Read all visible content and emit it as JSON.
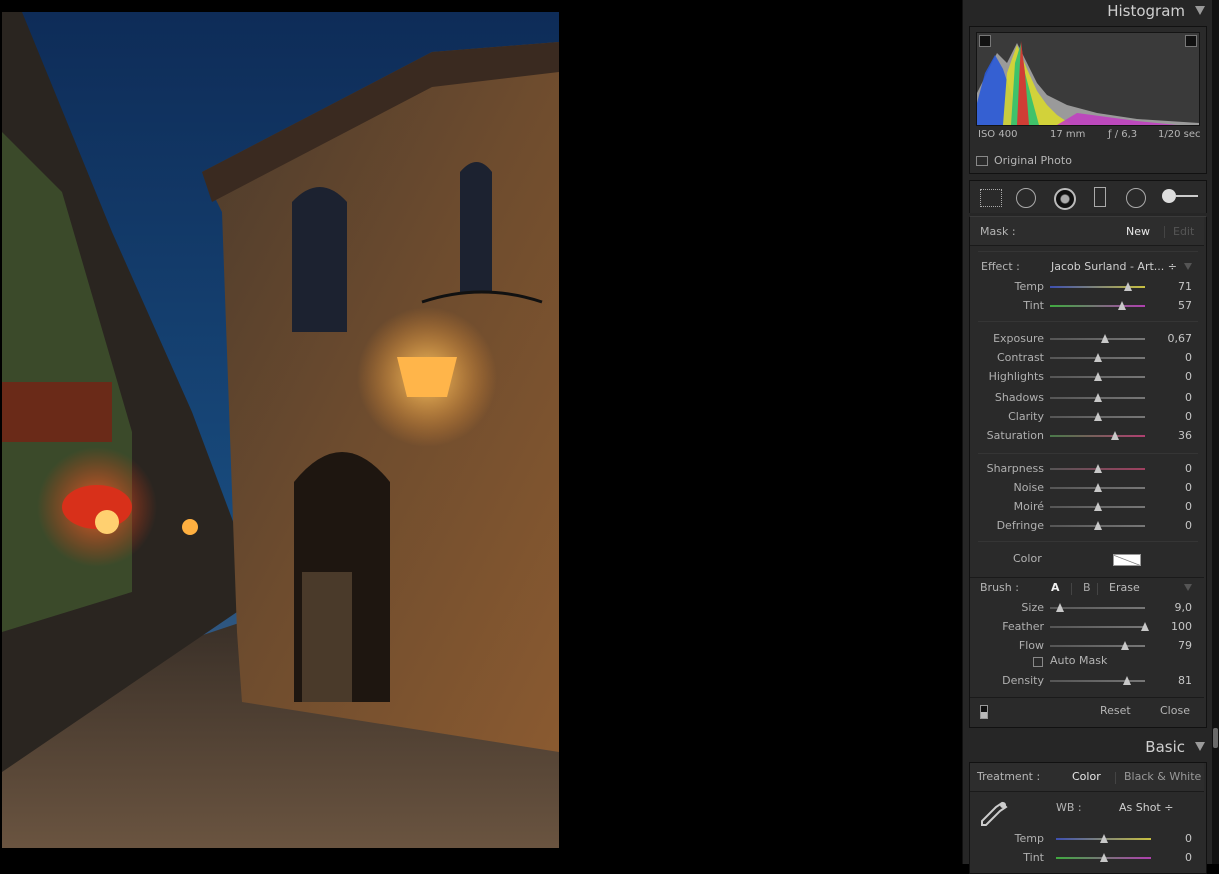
{
  "histogram": {
    "title": "Histogram",
    "iso": "ISO 400",
    "focal": "17 mm",
    "aperture": "ƒ / 6,3",
    "shutter": "1/20 sec",
    "original_photo": "Original Photo"
  },
  "mask": {
    "label": "Mask :",
    "new": "New",
    "edit": "Edit"
  },
  "effect": {
    "label": "Effect :",
    "preset": "Jacob Surland - Art... ÷",
    "sliders": [
      {
        "label": "Temp",
        "value": "71",
        "pos": 0.82,
        "gradient": "linear-gradient(90deg,#3d4fb0,#c8c040)"
      },
      {
        "label": "Tint",
        "value": "57",
        "pos": 0.76,
        "gradient": "linear-gradient(90deg,#3faa3f,#b03fb0)"
      },
      {
        "label": "Exposure",
        "value": "0,67",
        "pos": 0.58,
        "gradient": "linear-gradient(90deg,#555,#777)"
      },
      {
        "label": "Contrast",
        "value": "0",
        "pos": 0.5,
        "gradient": "linear-gradient(90deg,#555,#777)"
      },
      {
        "label": "Highlights",
        "value": "0",
        "pos": 0.5,
        "gradient": "linear-gradient(90deg,#555,#777)"
      },
      {
        "label": "Shadows",
        "value": "0",
        "pos": 0.5,
        "gradient": "linear-gradient(90deg,#555,#777)"
      },
      {
        "label": "Clarity",
        "value": "0",
        "pos": 0.5,
        "gradient": "linear-gradient(90deg,#555,#777)"
      },
      {
        "label": "Saturation",
        "value": "36",
        "pos": 0.68,
        "gradient": "linear-gradient(90deg,#4a7a4a,#b03f70)"
      },
      {
        "label": "Sharpness",
        "value": "0",
        "pos": 0.5,
        "gradient": "linear-gradient(90deg,#555,#a04060)"
      },
      {
        "label": "Noise",
        "value": "0",
        "pos": 0.5,
        "gradient": "linear-gradient(90deg,#555,#777)"
      },
      {
        "label": "Moiré",
        "value": "0",
        "pos": 0.5,
        "gradient": "linear-gradient(90deg,#555,#777)"
      },
      {
        "label": "Defringe",
        "value": "0",
        "pos": 0.5,
        "gradient": "linear-gradient(90deg,#555,#777)"
      }
    ],
    "color_label": "Color"
  },
  "brush": {
    "label": "Brush :",
    "a": "A",
    "b": "B",
    "erase": "Erase",
    "sliders": [
      {
        "label": "Size",
        "value": "9,0",
        "pos": 0.1
      },
      {
        "label": "Feather",
        "value": "100",
        "pos": 1.0
      },
      {
        "label": "Flow",
        "value": "79",
        "pos": 0.79
      },
      {
        "label": "Density",
        "value": "81",
        "pos": 0.81
      }
    ],
    "auto_mask": "Auto Mask"
  },
  "footer": {
    "reset": "Reset",
    "close": "Close"
  },
  "basic": {
    "title": "Basic",
    "treatment_label": "Treatment :",
    "color": "Color",
    "bw": "Black & White",
    "wb_label": "WB :",
    "wb_value": "As Shot ÷",
    "sliders": [
      {
        "label": "Temp",
        "value": "0",
        "pos": 0.5
      },
      {
        "label": "Tint",
        "value": "0",
        "pos": 0.5
      }
    ]
  }
}
